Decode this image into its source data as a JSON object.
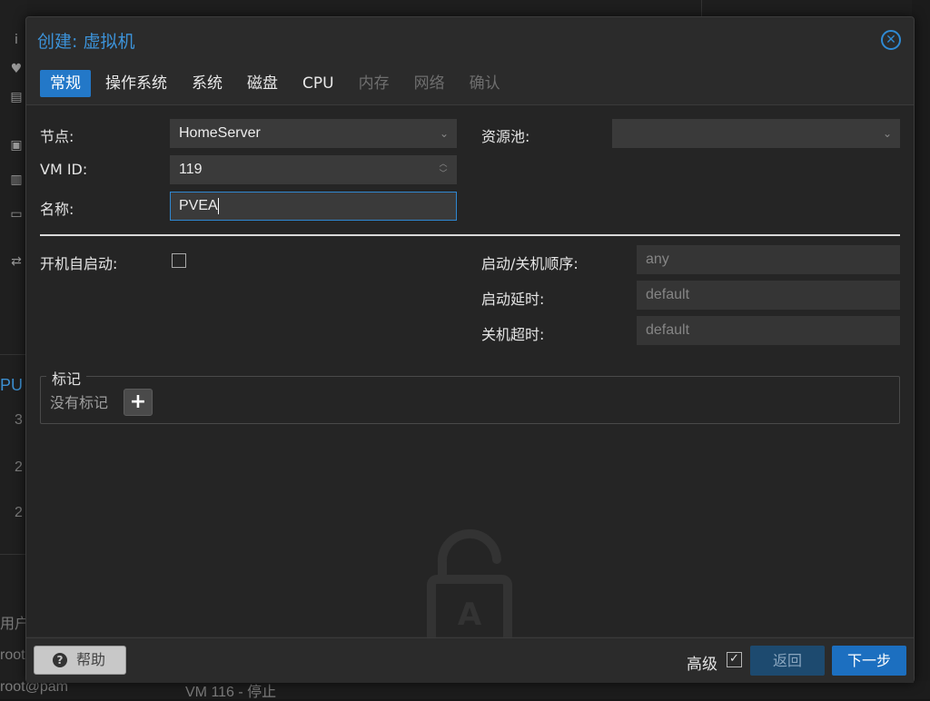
{
  "background": {
    "left_fragments": [
      "PU",
      "3",
      "2",
      "2",
      "用户",
      "root"
    ],
    "bottom_left": "root@pam",
    "bottom_status": "VM 116 - 停止"
  },
  "dialog": {
    "title": "创建: 虚拟机",
    "close_icon": "close-circle-icon",
    "tabs": [
      {
        "label": "常规",
        "state": "active"
      },
      {
        "label": "操作系统",
        "state": "enabled"
      },
      {
        "label": "系统",
        "state": "enabled"
      },
      {
        "label": "磁盘",
        "state": "enabled"
      },
      {
        "label": "CPU",
        "state": "enabled"
      },
      {
        "label": "内存",
        "state": "disabled"
      },
      {
        "label": "网络",
        "state": "disabled"
      },
      {
        "label": "确认",
        "state": "disabled"
      }
    ],
    "general": {
      "node_label": "节点:",
      "node_value": "HomeServer",
      "vmid_label": "VM ID:",
      "vmid_value": "119",
      "name_label": "名称:",
      "name_value": "PVEA",
      "pool_label": "资源池:",
      "pool_value": "",
      "autostart_label": "开机自启动:",
      "autostart_checked": false,
      "order_label": "启动/关机顺序:",
      "order_placeholder": "any",
      "startup_delay_label": "启动延时:",
      "startup_delay_placeholder": "default",
      "shutdown_timeout_label": "关机超时:",
      "shutdown_timeout_placeholder": "default"
    },
    "tags": {
      "legend": "标记",
      "empty_text": "没有标记",
      "add_icon": "plus-icon"
    },
    "footer": {
      "help_label": "帮助",
      "advanced_label": "高级",
      "advanced_checked": true,
      "back_label": "返回",
      "next_label": "下一步"
    }
  },
  "colors": {
    "accent": "#2378c8",
    "title": "#3c92d8",
    "dialog_bg": "#2b2b2b",
    "panel_bg": "#252525"
  }
}
